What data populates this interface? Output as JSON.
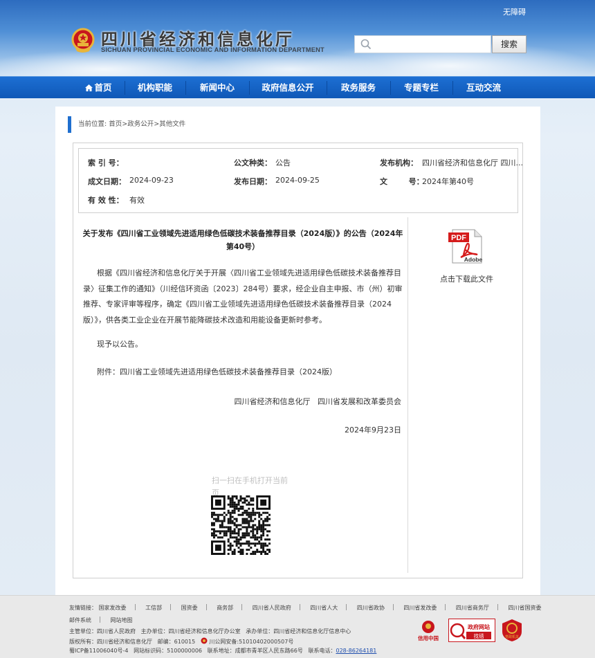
{
  "header": {
    "accessibility_label": "无障碍",
    "site_title": "四川省经济和信息化厅",
    "site_subtitle": "SICHUAN PROVINCIAL ECONOMIC AND INFORMATION DEPARTMENT",
    "search": {
      "placeholder": "",
      "button_label": "搜索"
    }
  },
  "nav": {
    "items": [
      {
        "label": "首页",
        "icon": "home-icon"
      },
      {
        "label": "机构职能"
      },
      {
        "label": "新闻中心"
      },
      {
        "label": "政府信息公开"
      },
      {
        "label": "政务服务"
      },
      {
        "label": "专题专栏"
      },
      {
        "label": "互动交流"
      }
    ]
  },
  "breadcrumb": {
    "prefix": "当前位置:",
    "items": [
      "首页",
      "政务公开",
      "其他文件"
    ],
    "separator": ">"
  },
  "meta": {
    "index_no_label": "索 引 号：",
    "index_no_value": "",
    "doc_type_label": "公文种类：",
    "doc_type_value": "公告",
    "publisher_label": "发布机构：",
    "publisher_value": "四川省经济和信息化厅  四川...",
    "created_date_label": "成文日期：",
    "created_date_value": "2024-09-23",
    "publish_date_label": "发布日期：",
    "publish_date_value": "2024-09-25",
    "doc_no_label": "文        号：",
    "doc_no_value": "2024年第40号",
    "validity_label": "有 效 性：",
    "validity_value": "有效"
  },
  "article": {
    "title": "关于发布《四川省工业领域先进适用绿色低碳技术装备推荐目录（2024版）》的公告（2024年第40号）",
    "paragraph1": "根据《四川省经济和信息化厅关于开展〈四川省工业领域先进适用绿色低碳技术装备推荐目录〉征集工作的通知》（川经信环资函〔2023〕284号）要求，经企业自主申报、市（州）初审推荐、专家评审等程序，确定《四川省工业领域先进适用绿色低碳技术装备推荐目录（2024版）》，供各类工业企业在开展节能降碳技术改造和用能设备更新时参考。",
    "paragraph2": "现予以公告。",
    "attachment": "附件：四川省工业领域先进适用绿色低碳技术装备推荐目录（2024版）",
    "signature": "四川省经济和信息化厅   四川省发展和改革委员会",
    "date": "2024年9月23日",
    "qr_caption": "扫一扫在手机打开当前页"
  },
  "sidebar": {
    "pdf_icon_text": "PDF",
    "adobe_text": "Adobe",
    "download_label": "点击下载此文件"
  },
  "footer": {
    "links_label": "友情链接：",
    "links": [
      "国家发改委",
      "工信部",
      "国资委",
      "商务部",
      "四川省人民政府",
      "四川省人大",
      "四川省政协",
      "四川省发改委",
      "四川省商务厅",
      "四川省国资委"
    ],
    "links_row2": [
      "邮件系统",
      "网站地图"
    ],
    "sponsor": "主管单位：四川省人民政府",
    "organizer": "主办单位：四川省经济和信息化厅办公室",
    "undertaker": "承办单位：四川省经济和信息化厅信息中心",
    "copyright": "版权所有：四川省经济和信息化厅",
    "postcode": "邮编：610015",
    "police_record": "川公网安备:51010402000507号",
    "icp": "蜀ICP备11006040号-4",
    "site_code": "网站标识码：5100000006",
    "address": "联系地址：成都市青羊区人民东路66号",
    "phone_label": "联系电话：",
    "phone": "028-86264181",
    "badges": {
      "credit_china": "信用中国",
      "gov_site_top": "政府网站",
      "gov_site_bottom": "找错",
      "party_org": "党政机关"
    }
  },
  "colors": {
    "nav_blue": "#1464c8",
    "accent_blue": "#1f6fcf",
    "emblem_red": "#c8161d",
    "pdf_red": "#d51b1b"
  }
}
